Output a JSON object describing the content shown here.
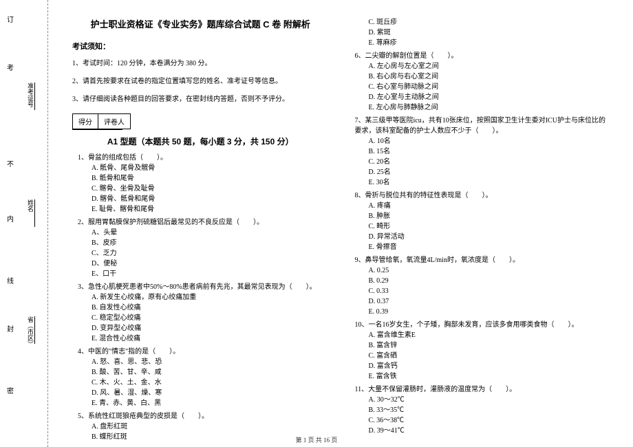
{
  "binding": {
    "labels": [
      "准考证号",
      "姓名",
      "省（市区）"
    ],
    "markers": [
      "订",
      "考",
      "不",
      "内",
      "线",
      "封",
      "密"
    ]
  },
  "title": "护士职业资格证《专业实务》题库综合试题 C 卷 附解析",
  "notice_header": "考试须知：",
  "notices": [
    "1、考试时间：120 分钟，本卷满分为 380 分。",
    "2、请首先按要求在试卷的指定位置填写您的姓名、准考证号等信息。",
    "3、请仔细阅读各种题目的回答要求，在密封线内答题，否则不予评分。"
  ],
  "score_table": {
    "col1": "得分",
    "col2": "评卷人"
  },
  "section_title": "A1 型题（本题共 50 题，每小题 3 分，共 150 分）",
  "questions_left": [
    {
      "stem": "1、骨盆的组成包括（　　）。",
      "options": [
        "A. 骶骨、尾骨及髋骨",
        "B. 骶骨和尾骨",
        "C. 髂骨、坐骨及耻骨",
        "D. 髂骨、骶骨和尾骨",
        "E. 耻骨、髂骨和尾骨"
      ]
    },
    {
      "stem": "2、服用胃黏膜保护剂硫糖铝后最常见的不良反应是（　　）。",
      "options": [
        "A、头晕",
        "B、皮疹",
        "C、乏力",
        "D、便秘",
        "E、口干"
      ]
    },
    {
      "stem": "3、急性心肌梗死患者中50%～80%患者病前有先兆，其最常见表现为（　　）。",
      "options": [
        "A. 新发生心绞痛，原有心绞痛加重",
        "B. 自发性心绞痛",
        "C. 稳定型心绞痛",
        "D. 变异型心绞痛",
        "E. 混合性心绞痛"
      ]
    },
    {
      "stem": "4、中医的\"情志\"指的是（　　）。",
      "options": [
        "A. 怒、喜、思、悲、恐",
        "B. 酸、苦、甘、辛、咸",
        "C. 木、火、土、金、水",
        "D. 风、暑、湿、燥、寒",
        "E. 青、赤、黄、白、黑"
      ]
    },
    {
      "stem": "5、系统性红斑狼疮典型的皮损是（　　）。",
      "options": [
        "A. 盘形红斑",
        "B. 蝶形红斑"
      ]
    }
  ],
  "questions_right": [
    {
      "stem": "",
      "options": [
        "C. 斑丘疹",
        "D. 紫斑",
        "E. 荨麻疹"
      ]
    },
    {
      "stem": "6、二尖瓣的解剖位置是（　　）。",
      "options": [
        "A. 左心房与左心室之间",
        "B. 右心房与右心室之间",
        "C. 右心室与肺动脉之间",
        "D. 左心室与主动脉之间",
        "E. 左心房与肺静脉之间"
      ]
    },
    {
      "stem": "7、某三级甲等医院icu，共有10张床位，按照国家卫生计生委对ICU护士与床位比的要求，该科室配备的护士人数应不少于（　　）。",
      "options": [
        "A. 10名",
        "B. 15名",
        "C. 20名",
        "D. 25名",
        "E. 30名"
      ]
    },
    {
      "stem": "8、骨折与脱位共有的特征性表现是（　　）。",
      "options": [
        "A. 疼痛",
        "B. 肿胀",
        "C. 畸形",
        "D. 异常活动",
        "E. 骨擦音"
      ]
    },
    {
      "stem": "9、鼻导管给氧，氧流量4L/min时，氧浓度是（　　）。",
      "options": [
        "A. 0.25",
        "B. 0.29",
        "C. 0.33",
        "D. 0.37",
        "E. 0.39"
      ]
    },
    {
      "stem": "10、一名16岁女生，个子矮，胸部未发育，应该多食用哪类食物（　　）。",
      "options": [
        "A. 富含维生素E",
        "B. 富含锌",
        "C. 富含硒",
        "D. 富含钙",
        "E. 富含铁"
      ]
    },
    {
      "stem": "11、大量不保留灌肠时，灌肠液的温度常为（　　）。",
      "options": [
        "A. 30～32℃",
        "B. 33～35℃",
        "C. 36～38℃",
        "D. 39～41℃"
      ]
    }
  ],
  "footer": "第 1 页 共 16 页"
}
